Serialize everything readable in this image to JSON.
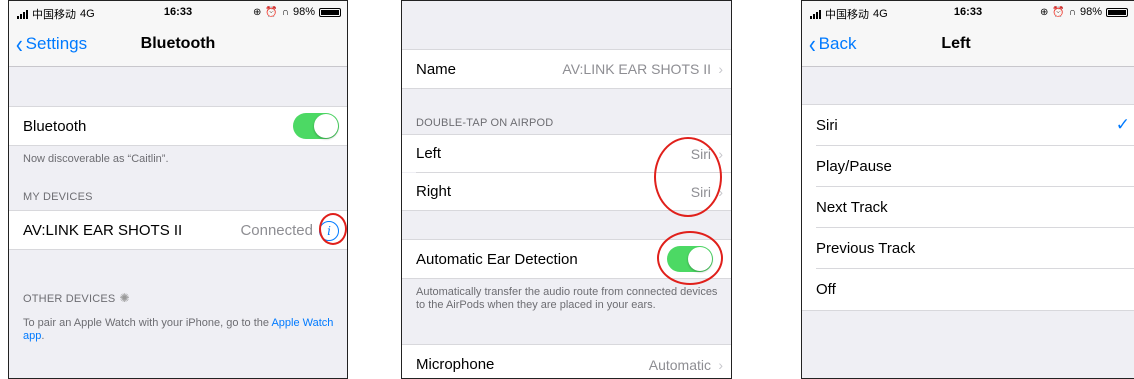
{
  "status": {
    "carrier": "中国移动",
    "network": "4G",
    "time": "16:33",
    "battery": "98%"
  },
  "screen1": {
    "back_label": "Settings",
    "title": "Bluetooth",
    "bluetooth_label": "Bluetooth",
    "bluetooth_on": true,
    "discoverable_text": "Now discoverable as “Caitlin”.",
    "my_devices_header": "MY DEVICES",
    "device_name": "AV:LINK EAR SHOTS II",
    "device_status": "Connected",
    "other_devices_header": "OTHER DEVICES",
    "pair_text_prefix": "To pair an Apple Watch with your iPhone, go to the ",
    "pair_link": "Apple Watch app",
    "pair_text_suffix": "."
  },
  "screen2": {
    "name_label": "Name",
    "name_value": "AV:LINK EAR SHOTS II",
    "double_tap_header": "DOUBLE-TAP ON AIRPOD",
    "left_label": "Left",
    "left_value": "Siri",
    "right_label": "Right",
    "right_value": "Siri",
    "ear_detection_label": "Automatic Ear Detection",
    "ear_detection_on": true,
    "ear_detection_note": "Automatically transfer the audio route from connected devices to the AirPods when they are placed in your ears.",
    "microphone_label": "Microphone",
    "microphone_value": "Automatic"
  },
  "screen3": {
    "back_label": "Back",
    "title": "Left",
    "options": [
      "Siri",
      "Play/Pause",
      "Next Track",
      "Previous Track",
      "Off"
    ],
    "selected": "Siri"
  },
  "colors": {
    "accent": "#007aff",
    "toggle_on": "#4cd964",
    "annotation": "#e0201b"
  }
}
